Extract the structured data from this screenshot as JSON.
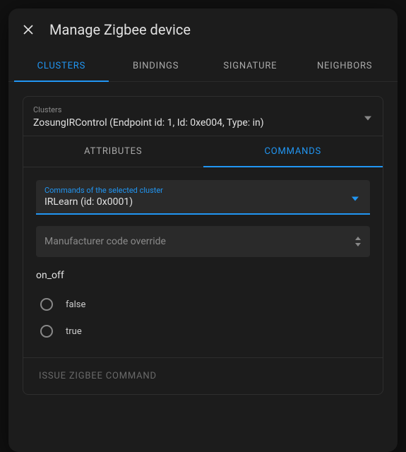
{
  "dialog": {
    "title": "Manage Zigbee device"
  },
  "tabs": [
    {
      "label": "CLUSTERS",
      "active": true
    },
    {
      "label": "BINDINGS",
      "active": false
    },
    {
      "label": "SIGNATURE",
      "active": false
    },
    {
      "label": "NEIGHBORS",
      "active": false
    }
  ],
  "cluster_select": {
    "label": "Clusters",
    "value": "ZosungIRControl (Endpoint id: 1, Id: 0xe004, Type: in)"
  },
  "subtabs": [
    {
      "label": "ATTRIBUTES",
      "active": false
    },
    {
      "label": "COMMANDS",
      "active": true
    }
  ],
  "command_select": {
    "label": "Commands of the selected cluster",
    "value": "IRLearn (id: 0x0001)"
  },
  "mfr_override": {
    "placeholder": "Manufacturer code override"
  },
  "param": {
    "name": "on_off",
    "options": [
      "false",
      "true"
    ]
  },
  "actions": {
    "issue": "ISSUE ZIGBEE COMMAND"
  }
}
